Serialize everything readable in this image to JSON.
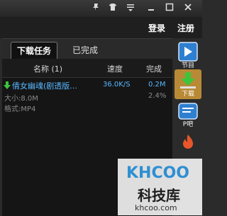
{
  "header": {
    "login": "登录",
    "register": "注册"
  },
  "tabs": [
    {
      "label": "下载任务"
    },
    {
      "label": "已完成"
    }
  ],
  "columns": {
    "name": "名称 (1)",
    "speed": "速度",
    "done": "完成"
  },
  "task": {
    "name": "倩女幽魂(剧透版...",
    "speed": "36.0K/S",
    "size_done": "0.2M",
    "percent": "2.4%",
    "size_label": "大小:8.0M",
    "format_label": "格式:MP4"
  },
  "sidebar": {
    "program": "节目",
    "download": "下载",
    "bar": "P吧"
  },
  "watermark": {
    "logo": "KHCOO",
    "cn": "科技库",
    "url": "khcoo.com"
  },
  "colors": {
    "accent": "#56b7ff",
    "active_bg": "#b98a35"
  }
}
